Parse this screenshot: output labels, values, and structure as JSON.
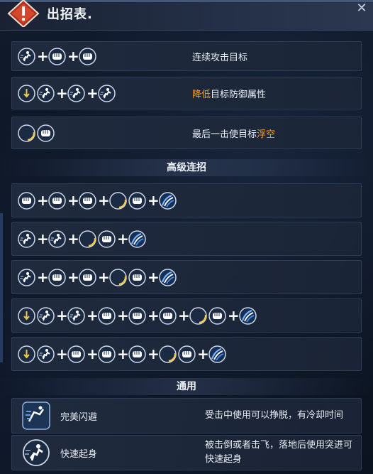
{
  "header": {
    "title": "出招表."
  },
  "basic": [
    {
      "combo": [
        "run",
        "plus",
        "fist",
        "plus",
        "fist"
      ],
      "desc": [
        {
          "t": "连续攻击目标",
          "hl": false
        }
      ]
    },
    {
      "combo": [
        "down",
        "run",
        "plus",
        "run",
        "plus",
        "run"
      ],
      "desc": [
        {
          "t": "降低",
          "hl": true
        },
        {
          "t": "目标防御属性",
          "hl": false
        }
      ]
    },
    {
      "combo": [
        "arc",
        "fist"
      ],
      "desc": [
        {
          "t": "最后一击使目标",
          "hl": false
        },
        {
          "t": "浮空",
          "hl": true
        }
      ]
    }
  ],
  "section_advanced": "高级连招",
  "advanced": [
    {
      "combo": [
        "fist",
        "plus",
        "fist",
        "plus",
        "fist",
        "plus",
        "arc",
        "fist",
        "plus",
        "wave"
      ]
    },
    {
      "combo": [
        "run",
        "plus",
        "run",
        "plus",
        "arc",
        "fist",
        "plus",
        "wave"
      ]
    },
    {
      "combo": [
        "run",
        "plus",
        "fist",
        "plus",
        "fist",
        "plus",
        "arc",
        "fist",
        "plus",
        "wave"
      ]
    },
    {
      "combo": [
        "down",
        "run",
        "plus",
        "run",
        "plus",
        "fist",
        "plus",
        "fist",
        "plus",
        "fist",
        "plus",
        "arc",
        "fist",
        "plus",
        "wave"
      ]
    },
    {
      "combo": [
        "down",
        "run",
        "plus",
        "fist",
        "plus",
        "fist",
        "plus",
        "fist",
        "plus",
        "arc",
        "fist",
        "plus",
        "wave"
      ]
    }
  ],
  "section_general": "通用",
  "general": [
    {
      "icon": "dodge",
      "name": "完美闪避",
      "desc": "受击中使用可以挣脱，有冷却时间"
    },
    {
      "icon": "run",
      "name": "快速起身",
      "desc": "被击倒或者击飞，落地后使用突进可快速起身"
    }
  ],
  "colors": {
    "highlight": "#f2a12b",
    "accent_blue": "#4f8fe0"
  }
}
